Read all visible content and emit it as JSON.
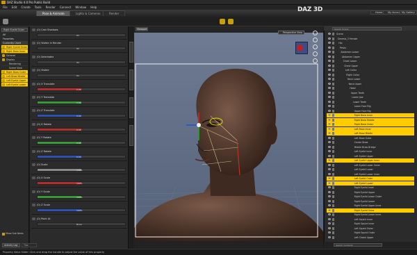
{
  "app": {
    "title": "DAZ Studio 4.0 Pro Public Build",
    "logo": "DAZ 3D"
  },
  "menu": [
    "File",
    "Edit",
    "Create",
    "Tools",
    "Render",
    "Connect",
    "Window",
    "Help"
  ],
  "main_tabs": [
    {
      "label": "Pose & Animate",
      "active": true
    },
    {
      "label": "Lights & Cameras",
      "active": false
    },
    {
      "label": "Render",
      "active": false
    }
  ],
  "top_links": [
    "Home",
    "My Account",
    "My Gallery"
  ],
  "left_panel": {
    "selector": "Right Eyelid Outer",
    "groups": [
      "All",
      "Favorites",
      "Currently Used"
    ],
    "items": [
      {
        "label": "Right Eyelid Outer",
        "highlight": true
      },
      {
        "label": "Right Brow Inner",
        "highlight": true
      },
      {
        "label": "General",
        "highlight": false
      },
      {
        "label": "Display",
        "highlight": false
      },
      {
        "label": "Rendering",
        "highlight": false
      },
      {
        "label": "Scene View",
        "highlight": false
      },
      {
        "label": "Right Brow Outer",
        "highlight": true
      },
      {
        "label": "Left Brow Middle",
        "highlight": true
      },
      {
        "label": "Left Eyelid Upper",
        "highlight": true
      },
      {
        "label": "Left Eyelid Lower",
        "highlight": true
      }
    ],
    "show_sub_items": "Show Sub Items"
  },
  "parameters": [
    {
      "label": "(0) Cast Shadows",
      "value": "On",
      "fill": 0,
      "color": "#5a5a5a"
    },
    {
      "label": "(0) Visible in Render",
      "value": "On",
      "fill": 0,
      "color": "#5a5a5a"
    },
    {
      "label": "(0) Selectable",
      "value": "On",
      "fill": 0,
      "color": "#5a5a5a"
    },
    {
      "label": "(0) Visible",
      "value": "On",
      "fill": 0,
      "color": "#5a5a5a"
    },
    {
      "label": "(0) X Translate",
      "value": "0.00",
      "fill": 0.5,
      "color": "#b03030"
    },
    {
      "label": "(0) Y Translate",
      "value": "0.00",
      "fill": 0.5,
      "color": "#3a9a3a"
    },
    {
      "label": "(0) Z Translate",
      "value": "0.00",
      "fill": 0.5,
      "color": "#3050b0"
    },
    {
      "label": "(0) X Rotate",
      "value": "0.00",
      "fill": 0.5,
      "color": "#b03030"
    },
    {
      "label": "(0) Y Rotate",
      "value": "0.00",
      "fill": 0.5,
      "color": "#3a9a3a"
    },
    {
      "label": "(0) Z Rotate",
      "value": "0.00",
      "fill": 0.5,
      "color": "#3050b0"
    },
    {
      "label": "(0) Scale",
      "value": "100%",
      "fill": 0.5,
      "color": "#8a8a8a"
    },
    {
      "label": "(0) X Scale",
      "value": "100%",
      "fill": 0.5,
      "color": "#b03030"
    },
    {
      "label": "(0) Y Scale",
      "value": "100%",
      "fill": 0.5,
      "color": "#3a9a3a"
    },
    {
      "label": "(0) Z Scale",
      "value": "100%",
      "fill": 0.5,
      "color": "#3050b0"
    },
    {
      "label": "(0) Point At",
      "value": "None",
      "fill": 0,
      "color": "#5a5a5a"
    }
  ],
  "param_selector": "Normal",
  "viewport": {
    "tab": "Viewport",
    "view": "Perspective View"
  },
  "scene_tree": {
    "search": "Search Scene",
    "nodes": [
      {
        "label": "Scene",
        "hl": false
      },
      {
        "label": "Genesis_3 Female",
        "hl": false
      },
      {
        "label": "Hip",
        "hl": false
      },
      {
        "label": "Pelvis",
        "hl": false
      },
      {
        "label": "Abdomen Lower",
        "hl": false
      },
      {
        "label": "Abdomen Upper",
        "hl": false
      },
      {
        "label": "Chest Lower",
        "hl": false
      },
      {
        "label": "Chest Upper",
        "hl": false
      },
      {
        "label": "Left Collar",
        "hl": false
      },
      {
        "label": "Right Collar",
        "hl": false
      },
      {
        "label": "Neck Lower",
        "hl": false
      },
      {
        "label": "Neck Upper",
        "hl": false
      },
      {
        "label": "Head",
        "hl": false
      },
      {
        "label": "Upper Teeth",
        "hl": false
      },
      {
        "label": "Lower Jaw",
        "hl": false
      },
      {
        "label": "Lower Teeth",
        "hl": false
      },
      {
        "label": "Lower Face Rig",
        "hl": false
      },
      {
        "label": "Upper Face Rig",
        "hl": false
      },
      {
        "label": "Right Brow Inner",
        "hl": true
      },
      {
        "label": "Right Brow Middle",
        "hl": true
      },
      {
        "label": "Right Brow Outer",
        "hl": true
      },
      {
        "label": "Left Brow Inner",
        "hl": true
      },
      {
        "label": "Left Brow Middle",
        "hl": true
      },
      {
        "label": "Left Brow Outer",
        "hl": false
      },
      {
        "label": "Center Brow",
        "hl": false
      },
      {
        "label": "Middle Brow Bridge",
        "hl": false
      },
      {
        "label": "Left Eyelid Inner",
        "hl": false
      },
      {
        "label": "Left Eyelid Upper",
        "hl": false
      },
      {
        "label": "Left Eyelid Upper Inner",
        "hl": true
      },
      {
        "label": "Left Eyelid Lower Outer",
        "hl": false
      },
      {
        "label": "Left Eyelid Lower",
        "hl": false
      },
      {
        "label": "Left Eyelid Lower Inner",
        "hl": false
      },
      {
        "label": "Left Eyelid Outer",
        "hl": true
      },
      {
        "label": "Left Eyelid Lower",
        "hl": true
      },
      {
        "label": "Right Eyelid Inner",
        "hl": false
      },
      {
        "label": "Right Eyelid Upper",
        "hl": false
      },
      {
        "label": "Right Eyelid Lower Outer",
        "hl": false
      },
      {
        "label": "Right Eyelid Lower",
        "hl": false
      },
      {
        "label": "Right Eyelid Upper Inner",
        "hl": false
      },
      {
        "label": "Right Eyelid Outer",
        "hl": true
      },
      {
        "label": "Right Eyelid Lower Inner",
        "hl": false
      },
      {
        "label": "Left Squint Inner",
        "hl": false
      },
      {
        "label": "Right Squint Inner",
        "hl": false
      },
      {
        "label": "Left Squint Outer",
        "hl": false
      },
      {
        "label": "Right Squint Outer",
        "hl": false
      },
      {
        "label": "Left Cheek Upper",
        "hl": false
      }
    ],
    "bottom_search": "Search Contents"
  },
  "bottom_tabs": [
    "Activity Log",
    "Tips"
  ],
  "status": "Property Value Slider: Click and drag the handle to adjust the value of this property"
}
